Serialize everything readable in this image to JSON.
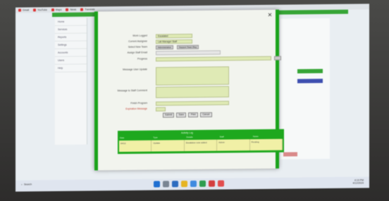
{
  "bookmarks": [
    "Gmail",
    "YouTube",
    "Maps",
    "News",
    "Translate"
  ],
  "background_page": {
    "nav_items": [
      "Home",
      "Services",
      "Reports",
      "Settings",
      "Accounts",
      "Users",
      "Help"
    ]
  },
  "modal": {
    "close_glyph": "✕",
    "fields": [
      {
        "label": "Work Logged",
        "value": "Escalated",
        "style": "green"
      },
      {
        "label": "Current Assignee",
        "value": "Lab Manager Staff",
        "style": "green"
      },
      {
        "label": "Select New Team",
        "value": "",
        "style": "gray"
      },
      {
        "label": "Assign Staff Email",
        "value": "",
        "style": "green"
      },
      {
        "label": "Progress",
        "value": "",
        "style": "green"
      },
      {
        "label": "Message User Update",
        "value": "",
        "style": "green"
      },
      {
        "label": "Message to Staff Comment",
        "value": "",
        "style": "green"
      },
      {
        "label": "Finish Program",
        "value": "",
        "style": "green"
      },
      {
        "label": "Expiration Message",
        "value": "",
        "style": "green"
      }
    ],
    "team_buttons": [
      "Administrative",
      "Support Team Reg"
    ],
    "actions": [
      "Submit",
      "Save",
      "Print",
      "Cancel"
    ],
    "grid": {
      "title": "Activity Log",
      "headers": [
        "Date",
        "Type",
        "Details",
        "Staff",
        "Notes"
      ],
      "row": [
        "04/12",
        "Update",
        "Escalation note added",
        "Admin",
        "Pending"
      ]
    }
  },
  "taskbar": {
    "search_label": "Search",
    "time": "4:19 PM",
    "date": "4/12/2024"
  }
}
